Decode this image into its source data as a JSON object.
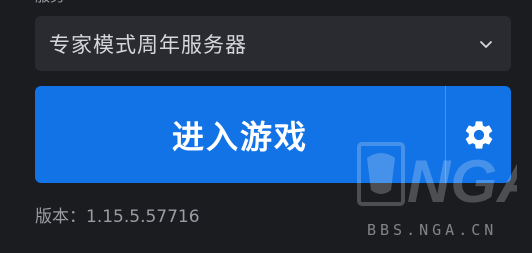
{
  "server_selector": {
    "label": "服务",
    "selected_value": "专家模式周年服务器"
  },
  "play": {
    "label": "进入游戏"
  },
  "version": {
    "text": "版本：1.15.5.57716"
  },
  "watermark": {
    "logo_text": "NGA",
    "site": "BBS.NGA.CN"
  },
  "icons": {
    "dropdown": "chevron-down-icon",
    "settings": "gear-icon"
  },
  "colors": {
    "background": "#1b1c20",
    "select_bg": "#2a2b30",
    "accent": "#1273e6"
  }
}
